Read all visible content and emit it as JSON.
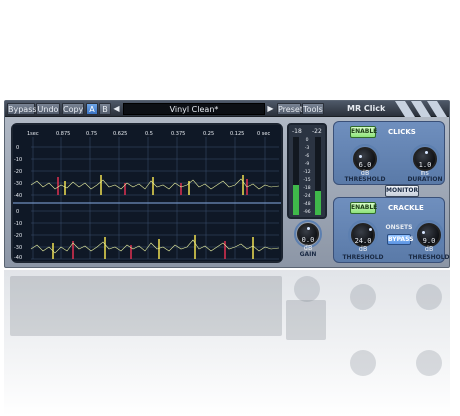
{
  "toolbar": {
    "bypass": "Bypass",
    "undo": "Undo",
    "copy": "Copy",
    "a_label": "A",
    "b_label": "B",
    "preset_name": "Vinyl Clean*",
    "preset": "Preset",
    "tools": "Tools",
    "plugin_name": "MR Click"
  },
  "graph": {
    "time_ticks": [
      "1sec",
      "0.875",
      "0.75",
      "0.625",
      "0.5",
      "0.375",
      "0.25",
      "0.125",
      "0 sec"
    ],
    "db_ticks_top": [
      "0",
      "-10",
      "-20",
      "-30",
      "-40"
    ],
    "db_ticks_bottom": [
      "0",
      "-10",
      "-20",
      "-30",
      "-40"
    ]
  },
  "meter": {
    "left_peak": "-18",
    "right_peak": "-22",
    "scale": [
      "0",
      "-3",
      "-6",
      "-9",
      "-12",
      "-15",
      "-18",
      "-24",
      "-48",
      "-96"
    ]
  },
  "gain": {
    "value": "0.0 dB",
    "label": "GAIN"
  },
  "clicks": {
    "enable": "ENABLE",
    "title": "CLICKS",
    "threshold_value": "6.0 dB",
    "threshold_label": "THRESHOLD",
    "duration_value": "1.0 ms",
    "duration_label": "DURATION"
  },
  "monitor": "MONITOR",
  "crackle": {
    "enable": "ENABLE",
    "title": "CRACKLE",
    "threshold_value": "24.0 dB",
    "threshold_label": "THRESHOLD",
    "onsets": "ONSETS",
    "bypass": "BYPASS",
    "threshold2_value": "9.0 dB",
    "threshold2_label": "THRESHOLD"
  },
  "colors": {
    "accent_blue": "#5d95e2",
    "enable_green": "#8ee27a",
    "waveform": "#e8f0a0",
    "click_marker_red": "#e03050",
    "click_marker_yellow": "#f0e050"
  }
}
